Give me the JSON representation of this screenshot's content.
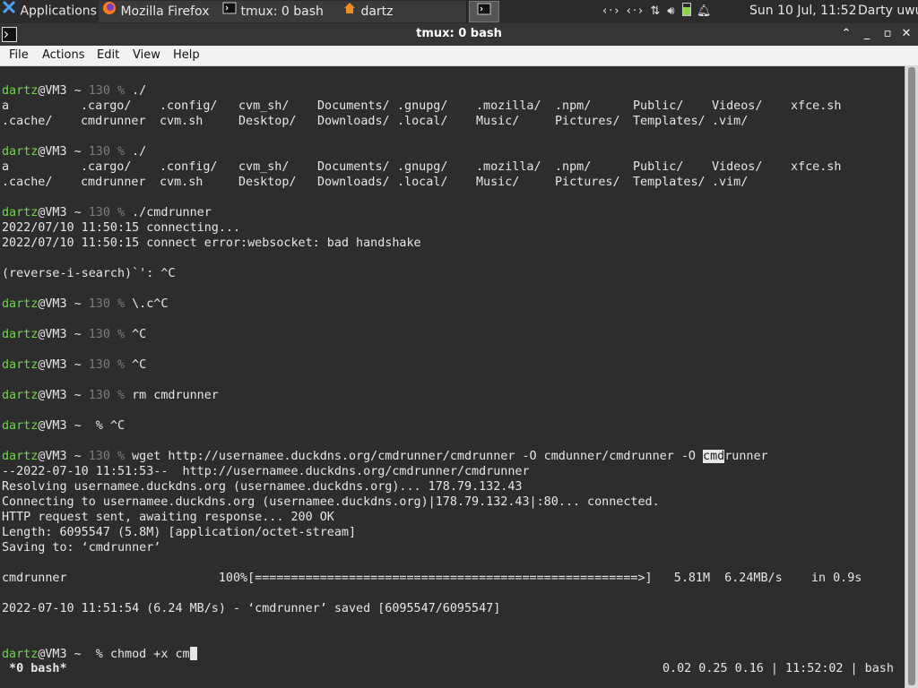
{
  "panel": {
    "applications": "Applications",
    "tasks": [
      {
        "label": "Mozilla Firefox",
        "icon": "firefox-icon"
      },
      {
        "label": "tmux: 0 bash",
        "icon": "terminal-icon"
      },
      {
        "label": "dartz",
        "icon": "home-folder-icon"
      }
    ],
    "clock": "Sun 10 Jul, 11:52",
    "user": "Darty uwu"
  },
  "window": {
    "title": "tmux: 0 bash",
    "menus": [
      "File",
      "Actions",
      "Edit",
      "View",
      "Help"
    ]
  },
  "prompt": {
    "user": "dartz",
    "at_host": "@VM3",
    "tilde": " ~ ",
    "code": "130",
    "percent": " % "
  },
  "ls_output": {
    "row1": [
      "a",
      ".cargo/",
      ".config/",
      "cvm_sh/",
      "Documents/",
      ".gnupg/",
      ".mozilla/",
      ".npm/",
      "Public/",
      "Videos/",
      "xfce.sh"
    ],
    "row2": [
      ".cache/",
      "cmdrunner",
      "cvm.sh",
      "Desktop/",
      "Downloads/",
      ".local/",
      "Music/",
      "Pictures/",
      "Templates/",
      ".vim/"
    ]
  },
  "commands": {
    "ls1": "./",
    "ls2": "./",
    "run": "./cmdrunner",
    "rev": "\\.c^C",
    "c1": "^C",
    "c2": "^C",
    "rm": "rm cmdrunner",
    "c3": "^C",
    "wget_before": "wget http://usernamee.duckdns.org/cmdrunner/cmdrunner -O cmdunner/cmdrunner -O ",
    "wget_hl": "cmd",
    "wget_after": "runner",
    "chmod": "chmod +x cm"
  },
  "output": {
    "o1": "2022/07/10 11:50:15 connecting...",
    "o2": "2022/07/10 11:50:15 connect error:websocket: bad handshake",
    "search": "(reverse-i-search)`': ^C",
    "w1": "--2022-07-10 11:51:53--  http://usernamee.duckdns.org/cmdrunner/cmdrunner",
    "w2": "Resolving usernamee.duckdns.org (usernamee.duckdns.org)... 178.79.132.43",
    "w3": "Connecting to usernamee.duckdns.org (usernamee.duckdns.org)|178.79.132.43|:80... connected.",
    "w4": "HTTP request sent, awaiting response... 200 OK",
    "w5": "Length: 6095547 (5.8M) [application/octet-stream]",
    "w6": "Saving to: ‘cmdrunner’",
    "progress": "cmdrunner                     100%[=====================================================>]   5.81M  6.24MB/s    in 0.9s",
    "saved": "2022-07-10 11:51:54 (6.24 MB/s) - ‘cmdrunner’ saved [6095547/6095547]"
  },
  "status_bar": {
    "left": " *0 bash*",
    "right": "0.02 0.25 0.16 | 11:52:02 | bash "
  },
  "colors": {
    "prompt_user": "#6fd64a",
    "terminal_bg": "#2d2d2d",
    "panel_bg": "#2b2b2b"
  }
}
